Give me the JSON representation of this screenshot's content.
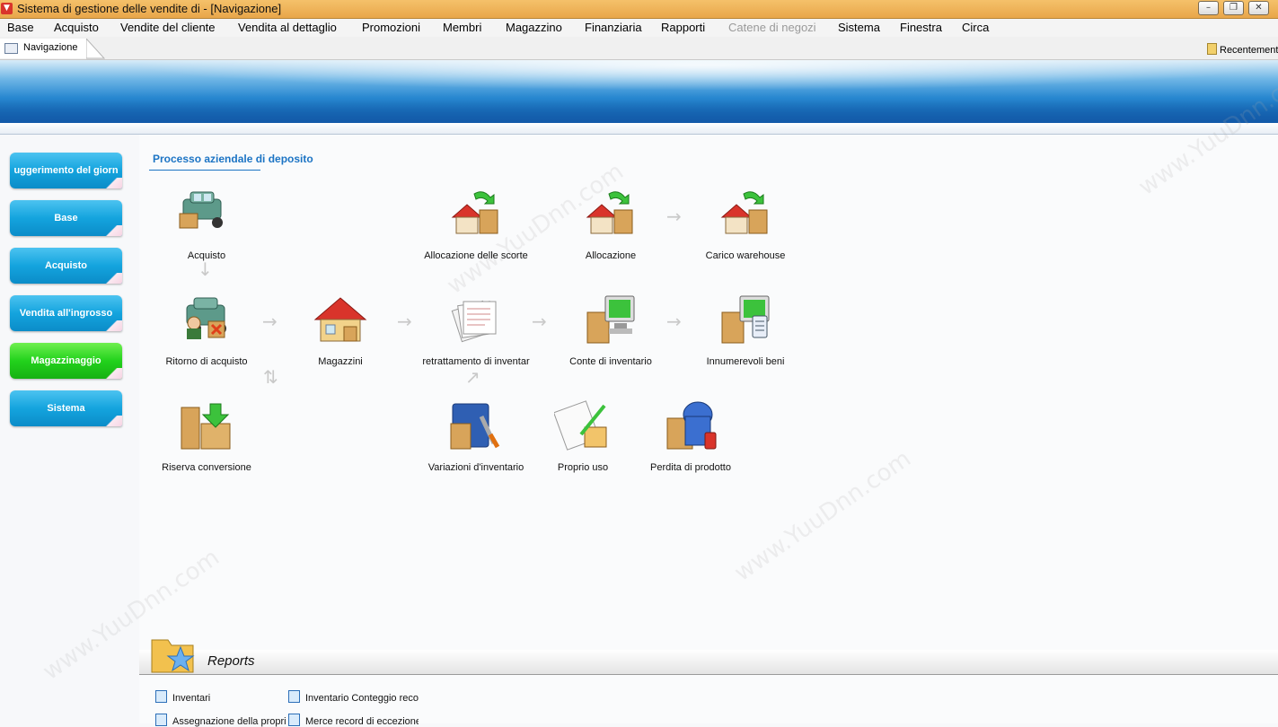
{
  "window": {
    "title": "Sistema di gestione delle vendite di  - [Navigazione]",
    "buttons": [
      "–",
      "❐",
      "✕"
    ]
  },
  "menu": [
    {
      "label": "Base",
      "disabled": false
    },
    {
      "label": "Acquisto",
      "disabled": false
    },
    {
      "label": "Vendite del cliente",
      "disabled": false
    },
    {
      "label": "Vendita al dettaglio",
      "disabled": false
    },
    {
      "label": "Promozioni",
      "disabled": false
    },
    {
      "label": "Membri",
      "disabled": false
    },
    {
      "label": "Magazzino",
      "disabled": false
    },
    {
      "label": "Finanziaria",
      "disabled": false
    },
    {
      "label": "Rapporti",
      "disabled": false
    },
    {
      "label": "Catene di negozi",
      "disabled": true
    },
    {
      "label": "Sistema",
      "disabled": false
    },
    {
      "label": "Finestra",
      "disabled": false
    },
    {
      "label": "Circa",
      "disabled": false
    }
  ],
  "tab": {
    "label": "Navigazione"
  },
  "recent": {
    "label": "Recentemente"
  },
  "sidebar": [
    {
      "label": "uggerimento del giorn",
      "color": "blue"
    },
    {
      "label": "Base",
      "color": "blue"
    },
    {
      "label": "Acquisto",
      "color": "blue"
    },
    {
      "label": "Vendita all'ingrosso",
      "color": "blue"
    },
    {
      "label": "Magazzinaggio",
      "color": "green"
    },
    {
      "label": "Sistema",
      "color": "blue"
    }
  ],
  "process": {
    "title": "Processo aziendale di deposito",
    "nodes": {
      "acquisto": "Acquisto",
      "allocazione_scorte": "Allocazione delle scorte",
      "allocazione": "Allocazione",
      "carico": "Carico warehouse",
      "ritorno": "Ritorno di acquisto",
      "magazzini": "Magazzini",
      "pretrattamento": "retrattamento di inventar",
      "conte": "Conte di inventario",
      "innumerevoli": "Innumerevoli beni",
      "riserva": "Riserva conversione",
      "variazioni": "Variazioni d'inventario",
      "proprio_uso": "Proprio uso",
      "perdita": "Perdita di prodotto"
    }
  },
  "reports": {
    "title": "Reports",
    "links": [
      "Inventari",
      "Inventario Conteggio reco",
      "Assegnazione della propri",
      "Merce record di eccezione"
    ]
  },
  "watermark": "www.YuuDnn.com",
  "colors": {
    "accent": "#1c74c4",
    "side_blue": "#14a4de",
    "side_green": "#22d21c",
    "banner": "#2787d0"
  }
}
